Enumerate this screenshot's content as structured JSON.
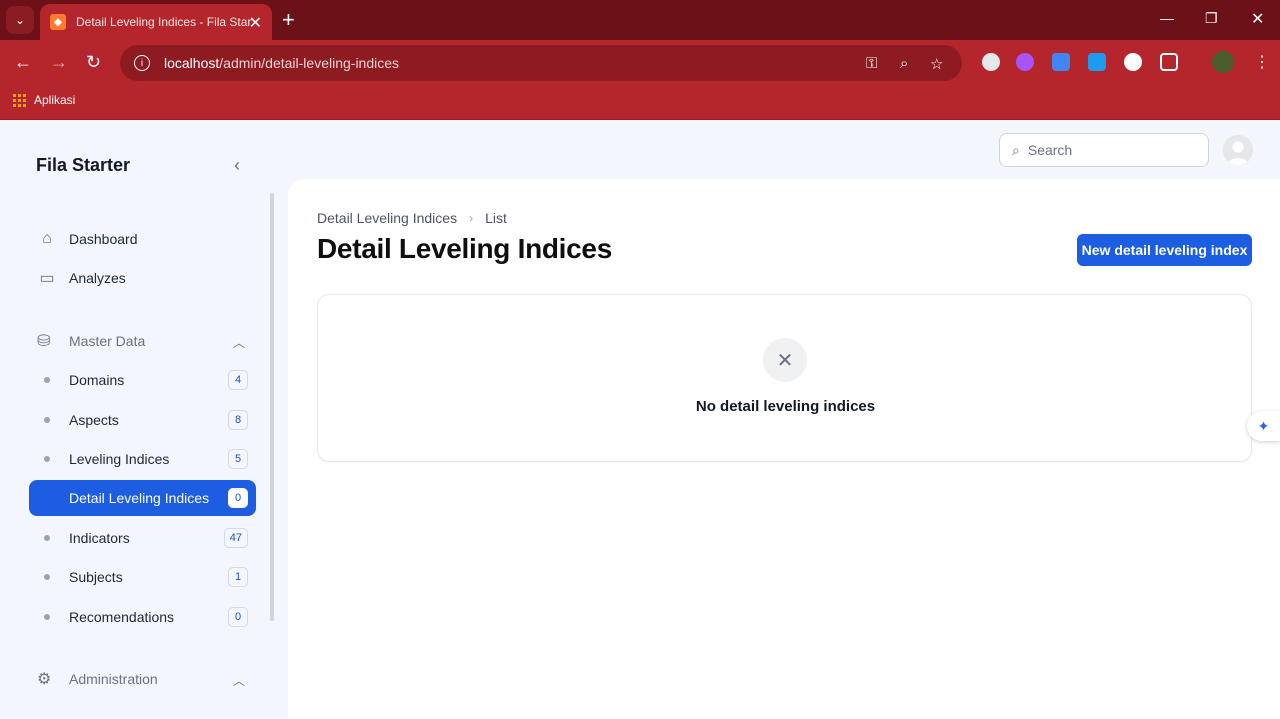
{
  "browser": {
    "tab_title": "Detail Leveling Indices - Fila Starter",
    "url_host": "localhost",
    "url_path": "/admin/detail-leveling-indices",
    "bookmark_apps": "Aplikasi"
  },
  "app": {
    "brand": "Fila Starter",
    "search_placeholder": "Search"
  },
  "sidebar": {
    "dashboard": "Dashboard",
    "analyzes": "Analyzes",
    "master_data": "Master Data",
    "items": [
      {
        "label": "Domains",
        "count": "4"
      },
      {
        "label": "Aspects",
        "count": "8"
      },
      {
        "label": "Leveling Indices",
        "count": "5"
      },
      {
        "label": "Detail Leveling Indices",
        "count": "0"
      },
      {
        "label": "Indicators",
        "count": "47"
      },
      {
        "label": "Subjects",
        "count": "1"
      },
      {
        "label": "Recomendations",
        "count": "0"
      }
    ],
    "administration": "Administration"
  },
  "main": {
    "breadcrumb": [
      "Detail Leveling Indices",
      "List"
    ],
    "title": "Detail Leveling Indices",
    "new_button": "New detail leveling index",
    "empty_text": "No detail leveling indices"
  },
  "colors": {
    "accent": "#1d5de0",
    "browser_frame": "#b5252c"
  }
}
